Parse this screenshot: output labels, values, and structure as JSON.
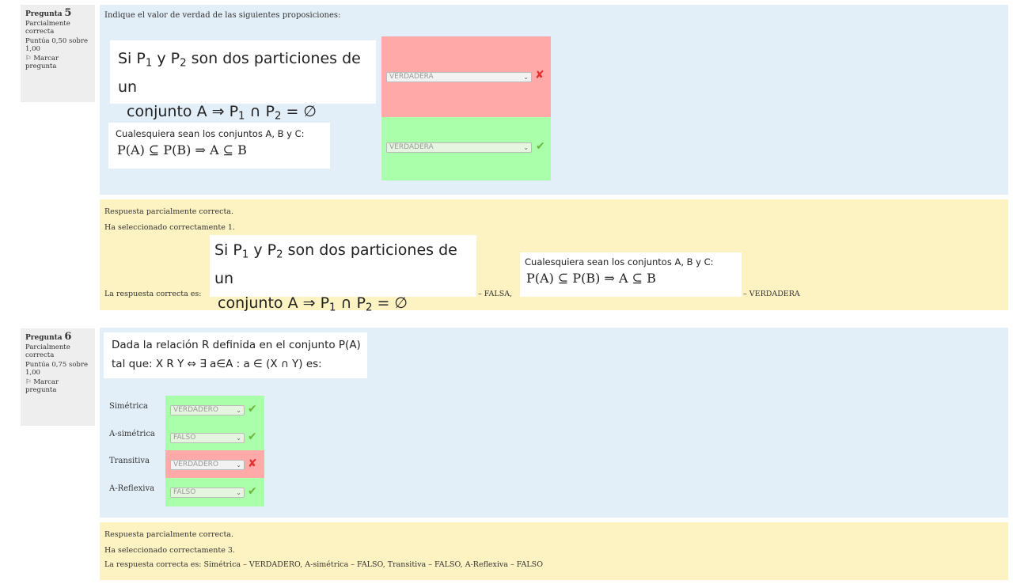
{
  "q5": {
    "label": "Pregunta",
    "number": "5",
    "status": "Parcialmente correcta",
    "score": "Puntúa 0,50 sobre 1,00",
    "flag": "Marcar pregunta",
    "text": "Indique el valor de verdad de las siguientes proposiciones:",
    "prop1_line1": "Si P",
    "prop1_line1b": " y P",
    "prop1_line1c": " son dos particiones de un",
    "prop1_line2": "conjunto A ⇒ P",
    "prop1_line2b": " ∩ P",
    "prop1_line2c": " = ∅",
    "sub1": "1",
    "sub2": "2",
    "prop2_line1": "Cualesquiera sean los conjuntos A, B y C:",
    "prop2_line2": "P(A) ⊆ P(B) ⇒ A ⊆ B",
    "select1": "VERDADERA",
    "select2": "VERDADERA",
    "feedback_line1": "Respuesta parcialmente correcta.",
    "feedback_line2": "Ha seleccionado correctamente 1.",
    "feedback_correct": "La respuesta correcta es:",
    "feedback_falsa": "– FALSA,",
    "feedback_verdadera": "– VERDADERA"
  },
  "q6": {
    "label": "Pregunta",
    "number": "6",
    "status": "Parcialmente correcta",
    "score": "Puntúa 0,75 sobre 1,00",
    "flag": "Marcar pregunta",
    "text_line1": "Dada la relación R definida en el conjunto P(A)",
    "text_line2": "tal que:   X R Y ⇔ ∃ a∈A : a ∈ (X ∩ Y)    es:",
    "rows": [
      {
        "label": "Simétrica",
        "value": "VERDADERO",
        "result": "ok"
      },
      {
        "label": "A-simétrica",
        "value": "FALSO",
        "result": "ok"
      },
      {
        "label": "Transitiva",
        "value": "VERDADERO",
        "result": "x"
      },
      {
        "label": "A-Reflexiva",
        "value": "FALSO",
        "result": "ok"
      }
    ],
    "feedback_line1": "Respuesta parcialmente correcta.",
    "feedback_line2": "Ha seleccionado correctamente 3.",
    "feedback_line3": "La respuesta correcta es: Simétrica – VERDADERO, A-simétrica – FALSO, Transitiva – FALSO, A-Reflexiva – FALSO"
  },
  "icons": {
    "ok": "✔",
    "x": "✘",
    "flag": "⚐",
    "chevron": "⌄"
  },
  "colors": {
    "question_bg": "#e2eef8",
    "feedback_bg": "#fdf2c1",
    "wrong_bg": "#ffa9a9",
    "right_bg": "#aaffaa"
  }
}
